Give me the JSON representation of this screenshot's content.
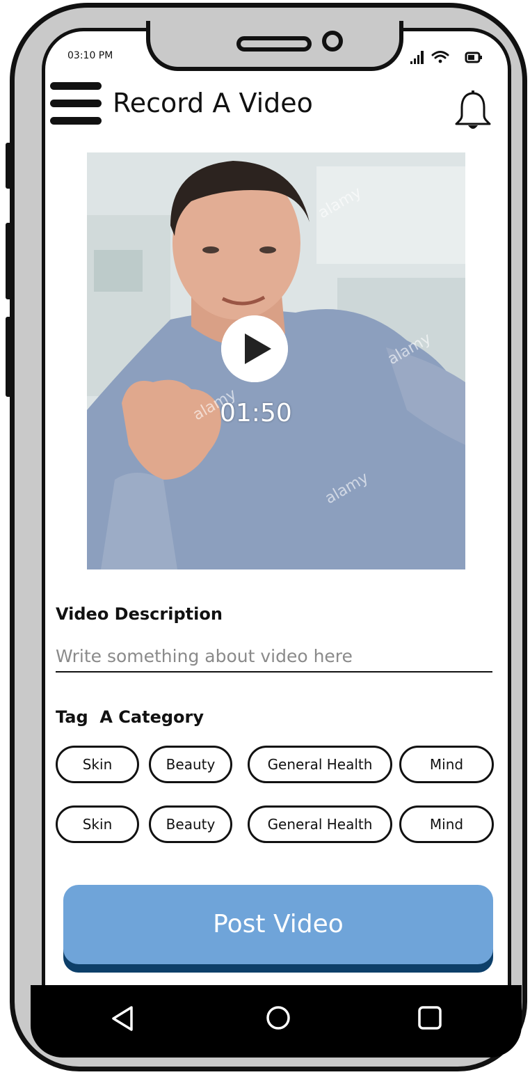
{
  "status_bar": {
    "time": "03:10 PM"
  },
  "header": {
    "title": "Record A Video",
    "menu_icon": "hamburger-icon",
    "notification_icon": "bell-icon"
  },
  "video": {
    "duration": "01:50",
    "play_icon": "play-icon"
  },
  "description": {
    "label": "Video Description",
    "placeholder": "Write something about video here"
  },
  "categories": {
    "label": "Tag  A Category",
    "rows": [
      [
        "Skin",
        "Beauty",
        "General Health",
        "Mind"
      ],
      [
        "Skin",
        "Beauty",
        "General Health",
        "Mind"
      ]
    ]
  },
  "post_button": {
    "label": "Post Video"
  },
  "navigation": {
    "back_icon": "back-triangle-icon",
    "home_icon": "home-circle-icon",
    "recent_icon": "recent-apps-square-icon"
  },
  "colors": {
    "accent": "#6fa4d9",
    "accent_shadow": "#0d3f69",
    "frame": "#c9c9c9"
  }
}
